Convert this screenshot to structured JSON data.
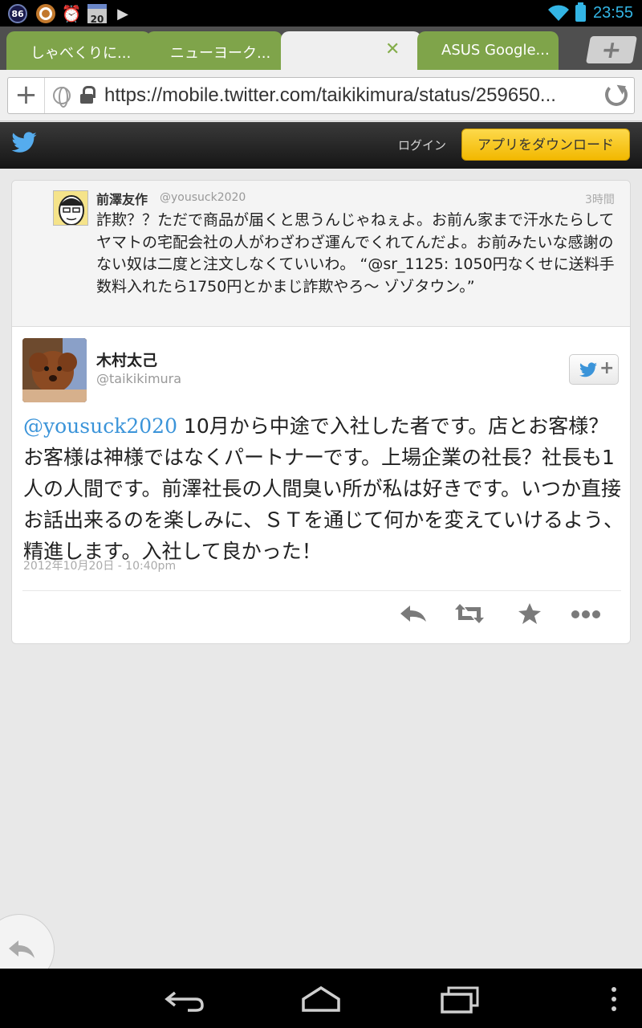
{
  "status_bar": {
    "notif_badge": "86",
    "calendar_day": "20",
    "time": "23:55"
  },
  "tabs": [
    {
      "label": "しゃべくりに..."
    },
    {
      "label": "ニューヨーク..."
    },
    {
      "label": ""
    },
    {
      "label": "ASUS Google..."
    }
  ],
  "url_bar": {
    "url": "https://mobile.twitter.com/taikikimura/status/259650..."
  },
  "twitter_header": {
    "login_label": "ログイン",
    "download_label": "アプリをダウンロード"
  },
  "in_reply_to": {
    "name": "前澤友作",
    "handle": "@yousuck2020",
    "time": "3時間",
    "text": "詐欺？？ただで商品が届くと思うんじゃねぇよ。お前ん家まで汗水たらしてヤマトの宅配会社の人がわざわざ運んでくれてんだよ。お前みたいな感謝のない奴は二度と注文しなくていいわ。 “@sr_1125: 1050円なくせに送料手数料入れたら1750円とかまじ詐欺やろ〜 ゾゾタウン。”"
  },
  "tweet": {
    "name": "木村太己",
    "handle": "@taikikimura",
    "mention": "@yousuck2020",
    "text": " 10月から中途で入社した者です。店とお客様？お客様は神様ではなくパートナーです。上場企業の社長？社長も1人の人間です。前澤社長の人間臭い所が私は好きです。いつか直接お話出来るのを楽しみに、ＳＴを通じて何かを変えていけるよう、精進します。入社して良かった！",
    "date": "2012年10月20日 - 10:40pm",
    "actions": [
      "reply-icon",
      "retweet-icon",
      "favorite-icon",
      "more-icon"
    ]
  },
  "colors": {
    "accent": "#33b5e5",
    "tab_green": "#7fa44a",
    "twitter_blue": "#3b94d9",
    "download_button": "#f7c600"
  }
}
